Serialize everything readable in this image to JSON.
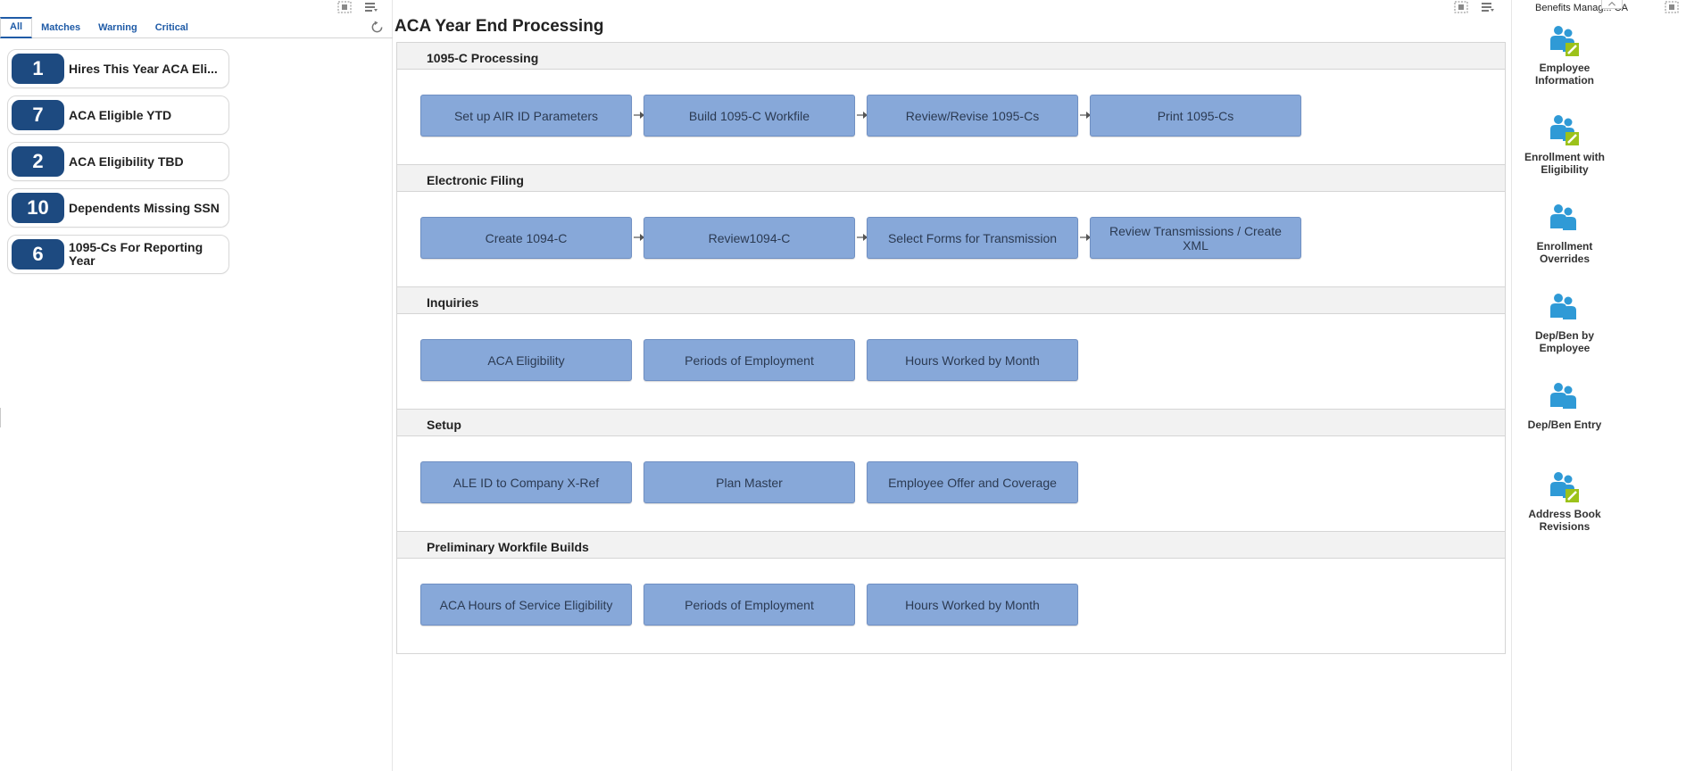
{
  "left": {
    "tabs": [
      "All",
      "Matches",
      "Warning",
      "Critical"
    ],
    "watchlists": [
      {
        "count": "1",
        "label": "Hires This Year ACA Eli..."
      },
      {
        "count": "7",
        "label": "ACA Eligible YTD"
      },
      {
        "count": "2",
        "label": "ACA Eligibility TBD"
      },
      {
        "count": "10",
        "label": "Dependents Missing SSN"
      },
      {
        "count": "6",
        "label": "1095-Cs For Reporting Year"
      }
    ]
  },
  "main": {
    "title": "ACA Year End Processing",
    "sections": [
      {
        "title": "1095-C Processing",
        "tasks": [
          "Set up AIR ID Parameters",
          "Build 1095-C Workfile",
          "Review/Revise 1095-Cs",
          "Print 1095-Cs"
        ]
      },
      {
        "title": "Electronic Filing",
        "tasks": [
          "Create 1094-C",
          "Review1094-C",
          "Select Forms for Transmission",
          "Review Transmissions / Create XML"
        ]
      },
      {
        "title": "Inquiries",
        "tasks": [
          "ACA Eligibility",
          "Periods of Employment",
          "Hours Worked by Month"
        ]
      },
      {
        "title": "Setup",
        "tasks": [
          "ALE ID to Company X-Ref",
          "Plan Master",
          "Employee Offer and Coverage"
        ]
      },
      {
        "title": "Preliminary Workfile Builds",
        "tasks": [
          "ACA Hours of Service Eligibility",
          "Periods of Employment",
          "Hours Worked by Month"
        ]
      }
    ]
  },
  "right": {
    "title": "Benefits Manag... CA",
    "apps": [
      {
        "label": "Employee Information",
        "icon": "people-edit-icon"
      },
      {
        "label": "Enrollment with Eligibility",
        "icon": "people-edit-icon"
      },
      {
        "label": "Enrollment Overrides",
        "icon": "people-icon"
      },
      {
        "label": "Dep/Ben by Employee",
        "icon": "people-icon"
      },
      {
        "label": "Dep/Ben Entry",
        "icon": "people-icon"
      },
      {
        "label": "Address Book Revisions",
        "icon": "people-edit-icon"
      }
    ]
  },
  "colors": {
    "accent": "#1f5ba7",
    "badge": "#1d4a80",
    "task_button": "#87a8d9",
    "icon_blue": "#2f9ad6",
    "icon_green": "#9cc21a"
  }
}
